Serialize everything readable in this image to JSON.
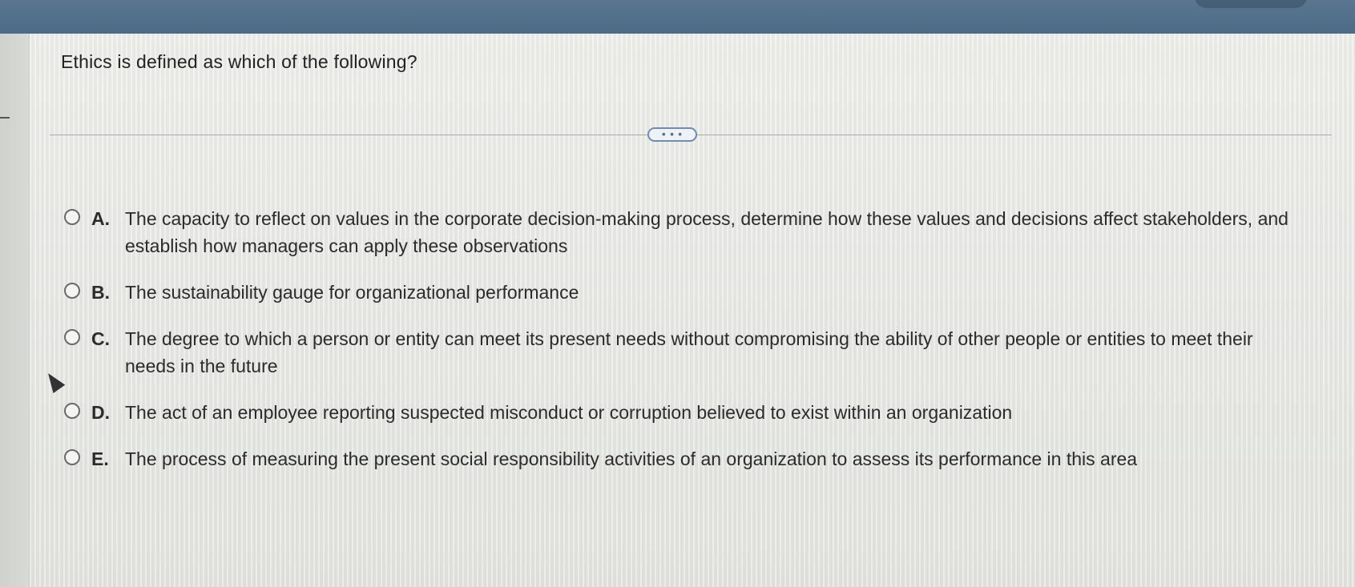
{
  "question": {
    "text": "Ethics is defined as which of the following?"
  },
  "expand_button": {
    "label": "• • •"
  },
  "options": [
    {
      "letter": "A.",
      "text": "The capacity to reflect on values in the corporate decision-making process, determine how these values and decisions affect stakeholders, and establish how managers can apply these observations",
      "selected": false
    },
    {
      "letter": "B.",
      "text": "The sustainability gauge for organizational performance",
      "selected": false
    },
    {
      "letter": "C.",
      "text": "The degree to which a person or entity can meet its present needs without compromising the ability of other people or entities to meet their needs in the future",
      "selected": false
    },
    {
      "letter": "D.",
      "text": "The act of an employee reporting suspected misconduct or corruption believed to exist within an organization",
      "selected": false
    },
    {
      "letter": "E.",
      "text": "The process of measuring the present social responsibility activities of an organization to assess its performance in this area",
      "selected": false
    }
  ],
  "colors": {
    "top_bar": "#4d6a86",
    "accent": "#6f8db0",
    "text": "#2b2b2b"
  }
}
